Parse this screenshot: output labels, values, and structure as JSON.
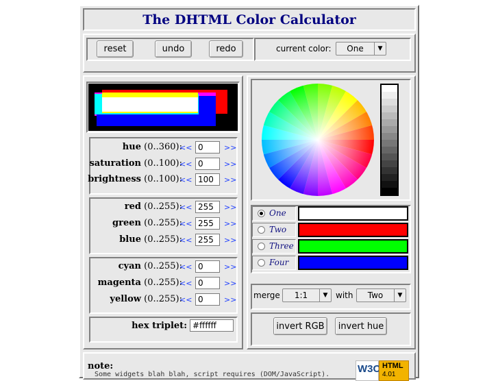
{
  "title": "The DHTML Color Calculator",
  "toolbar": {
    "reset_label": "reset",
    "undo_label": "undo",
    "redo_label": "redo",
    "current_color_label": "current color:",
    "current_color_value": "One"
  },
  "hsb": {
    "hue": {
      "name": "hue",
      "range": "(0..360):",
      "value": "0"
    },
    "saturation": {
      "name": "saturation",
      "range": "(0..100):",
      "value": "0"
    },
    "brightness": {
      "name": "brightness",
      "range": "(0..100):",
      "value": "100"
    }
  },
  "rgb": {
    "red": {
      "name": "red",
      "range": "(0..255):",
      "value": "255"
    },
    "green": {
      "name": "green",
      "range": "(0..255):",
      "value": "255"
    },
    "blue": {
      "name": "blue",
      "range": "(0..255):",
      "value": "255"
    }
  },
  "cmy": {
    "cyan": {
      "name": "cyan",
      "range": "(0..255):",
      "value": "0"
    },
    "magenta": {
      "name": "magenta",
      "range": "(0..255):",
      "value": "0"
    },
    "yellow": {
      "name": "yellow",
      "range": "(0..255):",
      "value": "0"
    }
  },
  "hex": {
    "label": "hex triplet:",
    "value": "#ffffff"
  },
  "arrows": {
    "left": "<<",
    "right": ">>"
  },
  "slots": [
    {
      "name": "One",
      "color": "#ffffff",
      "selected": true
    },
    {
      "name": "Two",
      "color": "#ff0000",
      "selected": false
    },
    {
      "name": "Three",
      "color": "#00ff00",
      "selected": false
    },
    {
      "name": "Four",
      "color": "#0000ff",
      "selected": false
    }
  ],
  "merge": {
    "label": "merge",
    "ratio": "1:1",
    "with_label": "with",
    "with_value": "Two"
  },
  "invert": {
    "rgb_label": "invert RGB",
    "hue_label": "invert hue"
  },
  "note": {
    "label": "note:",
    "text": "Some widgets blah blah, script requires (DOM/JavaScript)."
  },
  "badge": {
    "w3c": "W3C",
    "html": "HTML",
    "version": "4.01"
  }
}
